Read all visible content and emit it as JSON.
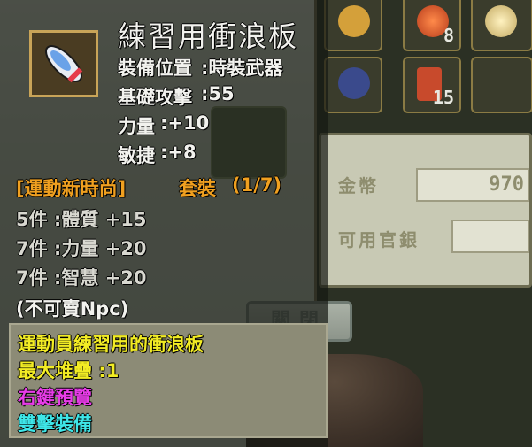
{
  "item": {
    "name": "練習用衝浪板",
    "stats": [
      {
        "label": "裝備位置",
        "value": ":時裝武器"
      },
      {
        "label": "基礎攻擊",
        "value": ":55"
      },
      {
        "label": "力量",
        "value": ":+10"
      },
      {
        "label": "敏捷",
        "value": ":+8"
      }
    ],
    "set": {
      "name": "[運動新時尚]",
      "suffix": "套裝",
      "progress": "(1/7)"
    },
    "set_bonuses": [
      "5件 :體質 +15",
      "7件 :力量 +20",
      "7件 :智慧 +20"
    ],
    "trade_note": "(不可賣Npc)",
    "description": "運動員練習用的衝浪板",
    "max_stack": "最大堆疊 :1",
    "right_click": "右鍵預覽",
    "dual_wield": "雙擊裝備"
  },
  "background": {
    "slot_counts": [
      "8",
      "15"
    ],
    "gold_label": "金幣",
    "gold_value": "970",
    "coupon_label": "可用官銀",
    "close_button": "關閉"
  },
  "colors": {
    "stat_white": "#f2f2ee",
    "set_orange": "#f0a020",
    "desc_yellow": "#f2ec24",
    "preview_magenta": "#e83ce8",
    "equip_cyan": "#3ee6e8"
  }
}
